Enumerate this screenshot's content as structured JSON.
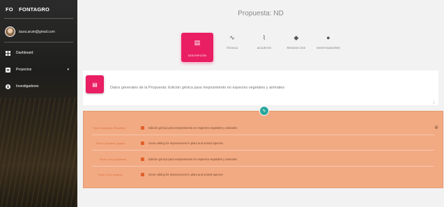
{
  "sidebar": {
    "brand_abbr": "FO",
    "brand_name": "FONTAGRO",
    "user_email": "laura.arum@gmail.com",
    "items": [
      {
        "label": "Dashboard",
        "icon": "dashboard-icon"
      },
      {
        "label": "Proyectos",
        "icon": "projects-icon",
        "caret": "▾"
      },
      {
        "label": "Investigadores",
        "icon": "user-icon"
      }
    ]
  },
  "header": {
    "title": "Propuesta: ND"
  },
  "tabs": [
    {
      "label": "DESCRIPCIÓN",
      "glyph": "▤",
      "active": true
    },
    {
      "label": "TÉCNICA",
      "glyph": "∿",
      "active": false
    },
    {
      "label": "ADJUNTOS",
      "glyph": "⌇",
      "active": false
    },
    {
      "label": "RIESGOS ODS",
      "glyph": "◆",
      "active": false
    },
    {
      "label": "INVESTIGADORES",
      "glyph": "●",
      "active": false
    }
  ],
  "card": {
    "badge": "▤",
    "title": "Datos generales de la Propuesta: Edición génica para mejoramiento en especies vegetales y animales",
    "small": "i"
  },
  "fab": "✎",
  "rows": [
    {
      "label": "Título Completo (Español)",
      "value": "Edición génica para mejoramiento en especies vegetales y animales"
    },
    {
      "label": "Título Completo (Inglés)",
      "value": "Gene editing for improvement in plant and animal species"
    },
    {
      "label": "Título Corto (Español)",
      "value": "Edición génica para mejoramiento en especies vegetales y animales"
    },
    {
      "label": "Título Corto (Inglés)",
      "value": "Gene editing for improvement in plant and animal species"
    }
  ],
  "close_glyph": "⊗",
  "colors": {
    "accent": "#e91e63",
    "teal": "#2aa79b",
    "highlight": "#f2aa83"
  }
}
